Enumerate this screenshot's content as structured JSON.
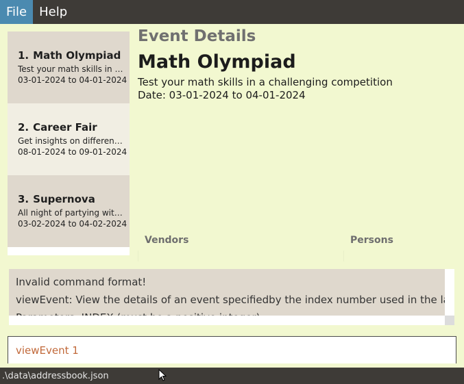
{
  "menu": {
    "file": "File",
    "help": "Help"
  },
  "events": [
    {
      "index": "1.",
      "name": "Math Olympiad",
      "description": "Test your math skills in a challenging competition",
      "dates": "03-01-2024 to 04-01-2024"
    },
    {
      "index": "2.",
      "name": "Career Fair",
      "description": "Get insights on different career paths",
      "dates": "08-01-2024 to 09-01-2024"
    },
    {
      "index": "3.",
      "name": "Supernova",
      "description": "All night of partying with friends",
      "dates": "03-02-2024 to 04-02-2024"
    }
  ],
  "details": {
    "header": "Event Details",
    "name": "Math Olympiad",
    "description": "Test your math skills in a challenging competition",
    "date": "Date: 03-01-2024 to 04-01-2024",
    "vendors_label": "Vendors",
    "persons_label": "Persons"
  },
  "result": {
    "line1": "Invalid command format!",
    "line2": "viewEvent: View the details of an event specifiedby the index number used in the last event listing.",
    "line3": "Parameters: INDEX (must be a positive integer)"
  },
  "command": {
    "value": "viewEvent 1"
  },
  "status": {
    "path": ".\\data\\addressbook.json"
  }
}
